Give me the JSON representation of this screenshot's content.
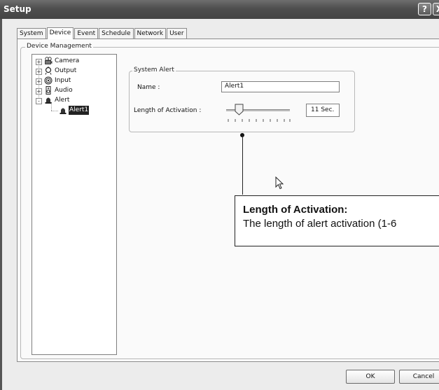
{
  "window": {
    "title": "Setup",
    "help_glyph": "?",
    "close_glyph": "X"
  },
  "tabs": [
    {
      "label": "System"
    },
    {
      "label": "Device",
      "active": true
    },
    {
      "label": "Event"
    },
    {
      "label": "Schedule"
    },
    {
      "label": "Network"
    },
    {
      "label": "User"
    }
  ],
  "device_management": {
    "group_label": "Device Management"
  },
  "tree": {
    "items": [
      {
        "label": "Camera",
        "icon": "camera-icon",
        "expander": "+"
      },
      {
        "label": "Output",
        "icon": "output-icon",
        "expander": "+"
      },
      {
        "label": "Input",
        "icon": "input-icon",
        "expander": "+"
      },
      {
        "label": "Audio",
        "icon": "audio-icon",
        "expander": "+"
      },
      {
        "label": "Alert",
        "icon": "alert-icon",
        "expander": "-"
      }
    ],
    "child": {
      "label": "Alert1",
      "icon": "alert-icon",
      "selected": true
    }
  },
  "system_alert": {
    "group_label": "System Alert",
    "name_label": "Name :",
    "name_value": "Alert1",
    "length_label": "Length of Activation :",
    "length_value": "11 Sec.",
    "slider_fraction": 0.2
  },
  "callout": {
    "title": "Length of Activation:",
    "text": "The length of alert activation  (1-6"
  },
  "buttons": {
    "ok": "OK",
    "cancel": "Cancel"
  }
}
